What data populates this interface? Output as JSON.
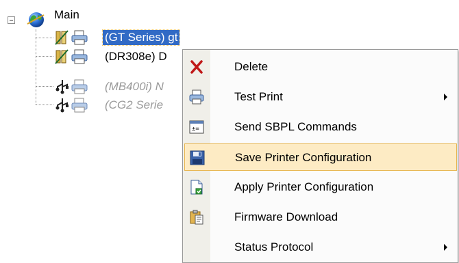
{
  "tree": {
    "root_label": "Main",
    "root_icon": "globe-icon",
    "nodes": [
      {
        "label": "(GT Series) gt",
        "connection_icon": "network-connection-icon",
        "selected": true,
        "disabled": false
      },
      {
        "label": "(DR308e) D",
        "connection_icon": "network-connection-icon",
        "selected": false,
        "disabled": false
      },
      {
        "label": "(MB400i) N",
        "connection_icon": "usb-icon",
        "selected": false,
        "disabled": true
      },
      {
        "label": "(CG2 Serie",
        "connection_icon": "usb-icon",
        "selected": false,
        "disabled": true
      }
    ]
  },
  "context_menu": {
    "items": [
      {
        "label": "Delete",
        "icon": "delete-x-icon",
        "has_submenu": false,
        "highlighted": false
      },
      {
        "label": "Test Print",
        "icon": "printer-icon",
        "has_submenu": true,
        "highlighted": false
      },
      {
        "label": "Send SBPL Commands",
        "icon": "command-window-icon",
        "has_submenu": false,
        "highlighted": false
      },
      {
        "label": "Save Printer Configuration",
        "icon": "floppy-disk-icon",
        "has_submenu": false,
        "highlighted": true
      },
      {
        "label": "Apply Printer Configuration",
        "icon": "apply-document-icon",
        "has_submenu": false,
        "highlighted": false
      },
      {
        "label": "Firmware Download",
        "icon": "clipboard-paste-icon",
        "has_submenu": false,
        "highlighted": false
      },
      {
        "label": "Status Protocol",
        "icon": "",
        "has_submenu": true,
        "highlighted": false
      }
    ]
  },
  "colors": {
    "selection_bg": "#316ac5",
    "menu_highlight_bg": "#fdebc4",
    "menu_highlight_border": "#e8b650",
    "disabled_text": "#9a9a9a"
  }
}
